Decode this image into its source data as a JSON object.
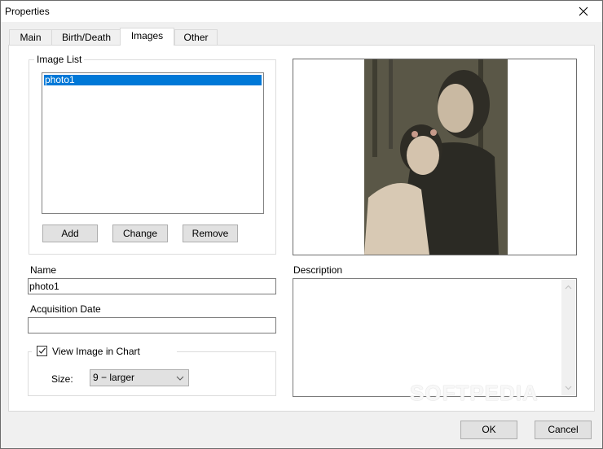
{
  "window": {
    "title": "Properties",
    "close_icon": "close-icon"
  },
  "tabs": [
    {
      "label": "Main",
      "active": false
    },
    {
      "label": "Birth/Death",
      "active": false
    },
    {
      "label": "Images",
      "active": true
    },
    {
      "label": "Other",
      "active": false
    }
  ],
  "image_list": {
    "legend": "Image List",
    "items": [
      "photo1"
    ],
    "selected": "photo1",
    "buttons": {
      "add": "Add",
      "change": "Change",
      "remove": "Remove"
    }
  },
  "fields": {
    "name_label": "Name",
    "name_value": "photo1",
    "acquisition_label": "Acquisition Date",
    "acquisition_value": "",
    "description_label": "Description",
    "description_value": ""
  },
  "view_in_chart": {
    "label": "View Image in Chart",
    "checked": true,
    "size_label": "Size:",
    "size_value": "9 − larger"
  },
  "preview": {
    "alt": "Sepia photo of a smiling couple embracing in a forest"
  },
  "footer": {
    "ok": "OK",
    "cancel": "Cancel"
  },
  "watermark": "SOFTPEDIA",
  "colors": {
    "selection": "#0078d7",
    "button_face": "#e1e1e1",
    "dialog_bg": "#f0f0f0"
  }
}
